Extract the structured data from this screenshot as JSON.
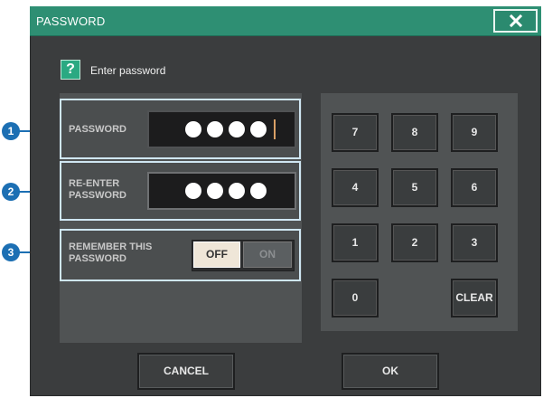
{
  "dialog": {
    "title": "PASSWORD",
    "close_icon": "close-icon",
    "prompt_icon": "?",
    "prompt": "Enter password"
  },
  "fields": {
    "password_label": "PASSWORD",
    "password_value": "••••",
    "reenter_label_line1": "RE-ENTER",
    "reenter_label_line2": "PASSWORD",
    "reenter_value": "••••",
    "remember_label_line1": "REMEMBER THIS",
    "remember_label_line2": "PASSWORD",
    "remember_off": "OFF",
    "remember_on": "ON",
    "remember_selected": "OFF"
  },
  "numpad": {
    "keys": [
      "7",
      "8",
      "9",
      "4",
      "5",
      "6",
      "1",
      "2",
      "3",
      "0",
      "CLEAR"
    ]
  },
  "buttons": {
    "cancel": "CANCEL",
    "ok": "OK"
  },
  "markers": [
    "1",
    "2",
    "3"
  ],
  "colors": {
    "title_bar": "#2e8f73",
    "panel": "#505354",
    "dialog_bg": "#3b3d3e",
    "marker_blue": "#1c6fb3",
    "highlight_border": "#cfe6f2"
  }
}
